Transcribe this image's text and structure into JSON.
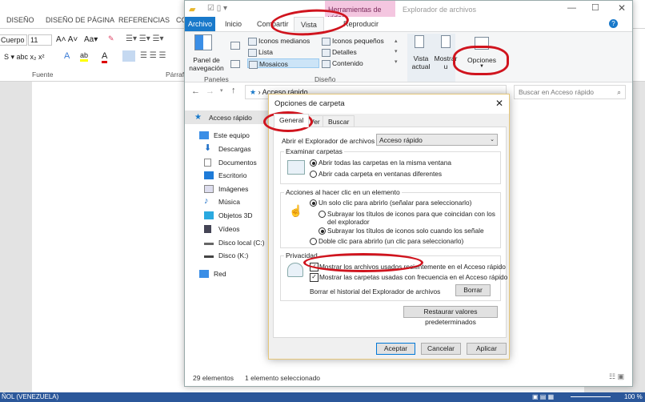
{
  "word": {
    "tabs": [
      "DISEÑO",
      "DISEÑO DE PÁGINA",
      "REFERENCIAS",
      "CO"
    ],
    "font_name": "Cuerpo",
    "font_size": "11",
    "groups": [
      "Fuente",
      "Párraf"
    ],
    "status_language": "ÑOL (VENEZUELA)",
    "zoom": "100 %"
  },
  "explorer": {
    "contextual_tab": "Herramientas de vídeo",
    "title": "Explorador de archivos",
    "tabs": [
      "Archivo",
      "Inicio",
      "Compartir",
      "Vista",
      "Reproducir"
    ],
    "ribbon": {
      "nav_pane": "Panel de navegación",
      "layouts": [
        "Iconos medianos",
        "Lista",
        "Mosaicos",
        "Iconos pequeños",
        "Detalles",
        "Contenido"
      ],
      "current_view": "Vista actual",
      "show_hide": "Mostrar u ocultar",
      "options": "Opciones",
      "groups": [
        "Paneles",
        "Diseño"
      ]
    },
    "address": "Acceso rápido",
    "search_placeholder": "Buscar en Acceso rápido",
    "nav": [
      "Acceso rápido",
      "Este equipo",
      "Descargas",
      "Documentos",
      "Escritorio",
      "Imágenes",
      "Música",
      "Objetos 3D",
      "Vídeos",
      "Disco local (C:)",
      "Disco (K:)",
      "Red"
    ],
    "status": {
      "count": "29 elementos",
      "selected": "1 elemento seleccionado"
    }
  },
  "dialog": {
    "title": "Opciones de carpeta",
    "tabs": [
      "General",
      "Ver",
      "Buscar"
    ],
    "open_in_label": "Abrir el Explorador de archivos en:",
    "open_in_value": "Acceso rápido",
    "browse": {
      "legend": "Examinar carpetas",
      "options": [
        "Abrir todas las carpetas en la misma ventana",
        "Abrir cada carpeta en ventanas diferentes"
      ]
    },
    "click": {
      "legend": "Acciones al hacer clic en un elemento",
      "options": [
        "Un solo clic para abrirlo (señalar para seleccionarlo)",
        "Subrayar los títulos de iconos para que coincidan con los del explorador",
        "Subrayar los títulos de iconos solo cuando los señale",
        "Doble clic para abrirlo (un clic para seleccionarlo)"
      ]
    },
    "privacy": {
      "legend": "Privacidad",
      "checks": [
        "Mostrar los archivos usados recientemente en el Acceso rápido",
        "Mostrar las carpetas usadas con frecuencia en el Acceso rápido"
      ],
      "clear_label": "Borrar el historial del Explorador de archivos",
      "clear_button": "Borrar"
    },
    "restore": "Restaurar valores predeterminados",
    "buttons": [
      "Aceptar",
      "Cancelar",
      "Aplicar"
    ]
  },
  "colors": {
    "accent": "#1979ca",
    "highlight": "#d0141e",
    "word_blue": "#2b579a"
  }
}
